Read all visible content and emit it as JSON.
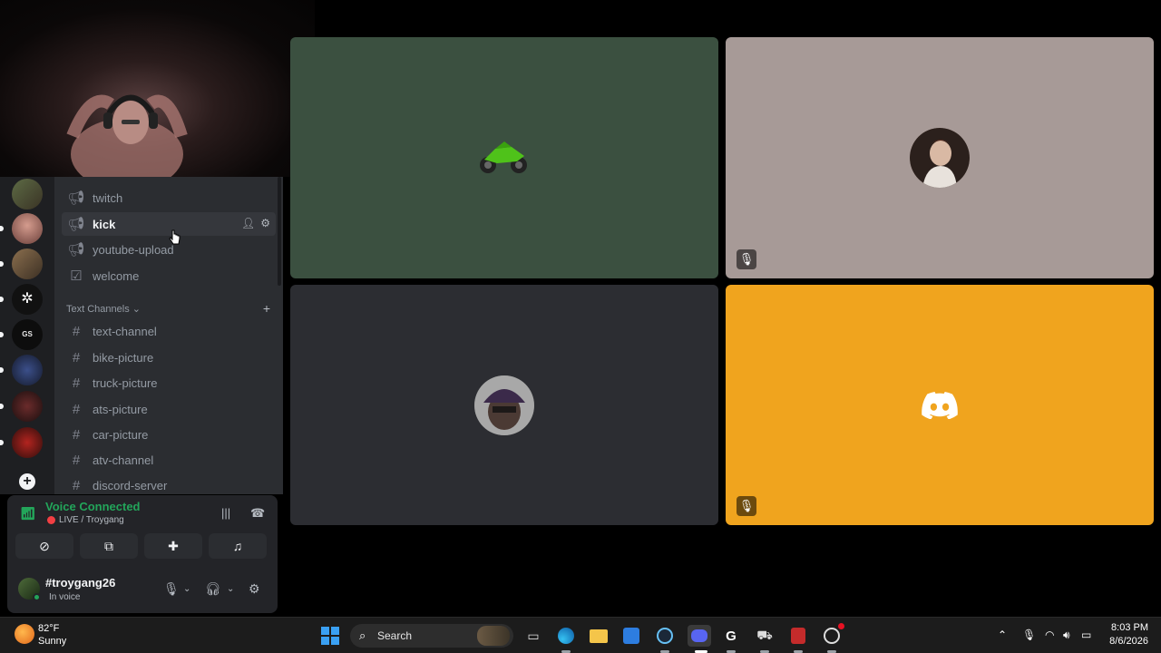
{
  "channels": {
    "announce": [
      {
        "label": "twitch",
        "icon": "megaphone-icon"
      },
      {
        "label": "kick",
        "icon": "megaphone-icon"
      },
      {
        "label": "youtube-upload",
        "icon": "megaphone-icon"
      },
      {
        "label": "welcome",
        "icon": "rules-icon"
      }
    ],
    "category": "Text Channels",
    "text": [
      "text-channel",
      "bike-picture",
      "truck-picture",
      "ats-picture",
      "car-picture",
      "atv-channel",
      "discord-server"
    ]
  },
  "voice": {
    "title": "Voice Connected",
    "subtitle": "LIVE / Troygang"
  },
  "user": {
    "name": "#troygang26",
    "status": "In voice"
  },
  "taskbar": {
    "temp": "82°F",
    "condition": "Sunny",
    "search_placeholder": "Search",
    "time": "8:03 PM",
    "date": "8/6/2026"
  },
  "colors": {
    "voice_connected": "#23a55a",
    "tile_orange": "#f0a41e",
    "tile_green": "#3b5040",
    "tile_gray": "#a79a97",
    "tile_dark": "#2c2d32"
  }
}
